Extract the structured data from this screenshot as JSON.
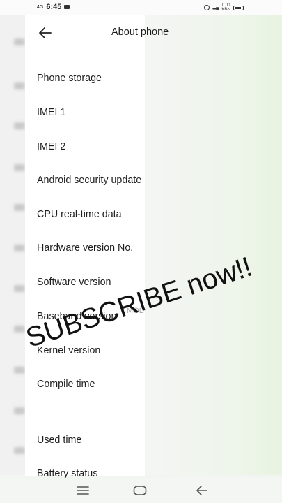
{
  "status_bar": {
    "network": "4G",
    "time": "6:45",
    "speed": "0.00",
    "speed_unit": "KB/s"
  },
  "header": {
    "title": "About phone"
  },
  "menu": [
    "Phone storage",
    "IMEI 1",
    "IMEI 2",
    "Android security update",
    "CPU real-time data",
    "Hardware version No.",
    "Software version",
    "Baseband version",
    "Kernel version",
    "Compile time",
    "Used time",
    "Battery status"
  ],
  "overlay": {
    "mol_text": "MOL",
    "watermark": "SUBSCRIBE now!!"
  },
  "colors": {
    "panel": "#ffffff",
    "background": "#f3f5f3",
    "text": "#1d1d1d"
  }
}
